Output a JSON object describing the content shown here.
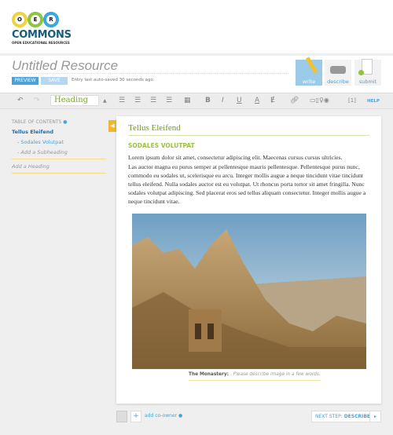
{
  "logo": {
    "letters": [
      "O",
      "E",
      "R"
    ],
    "name": "COMMONS",
    "tagline": "OPEN EDUCATIONAL RESOURCES"
  },
  "resource": {
    "title": "Untitled Resource",
    "preview": "PREVIEW",
    "save": "SAVE",
    "autosave": "Entry last auto-saved 30 seconds ago."
  },
  "steps": [
    {
      "label": "write",
      "active": true
    },
    {
      "label": "describe",
      "active": false
    },
    {
      "label": "submit",
      "active": false
    }
  ],
  "toolbar": {
    "format": "Heading",
    "footnote": "[1]",
    "help": "HELP"
  },
  "toc": {
    "label": "TABLE OF CONTENTS",
    "items": [
      {
        "label": "Tellus Eleifend"
      },
      {
        "label": "- Sodales Volutpat"
      },
      {
        "label": "- Add a Subheading"
      },
      {
        "label": "Add a Heading"
      }
    ]
  },
  "content": {
    "heading": "Tellus Eleifend",
    "subheading": "SODALES VOLUTPAT",
    "p1": "Lorem ipsum dolor sit amet, consectetur adipiscing elit. Maecenas cursus cursus ultricies.",
    "p2": "Las auctor magna eu purus semper at pellentesque mauris pellentesque. Pellentesque purus nunc, commodo eu sodales ut, scelerisque eu arcu. Integer mollis augue a neque tincidunt vitae tincidunt tellus eleifend. Nulla sodales auctor est eu volutpat. Ut rhoncus porta tortor sit amet fringilla. Nunc sodales volutpat adipiscing. Sed placerat eros sed tellus aliquam consectetur. Integer mollis augue a neque tincidunt vitae.",
    "caption_title": "The Monastery:",
    "caption_placeholder": "Please describe image in a few words."
  },
  "footer": {
    "add_coowner": "add co-owner",
    "next_label": "NEXT STEP:",
    "next_step": "DESCRIBE"
  },
  "colors": {
    "accent": "#4aa2d8",
    "green": "#7aa82a",
    "yellow": "#f2b62a"
  }
}
